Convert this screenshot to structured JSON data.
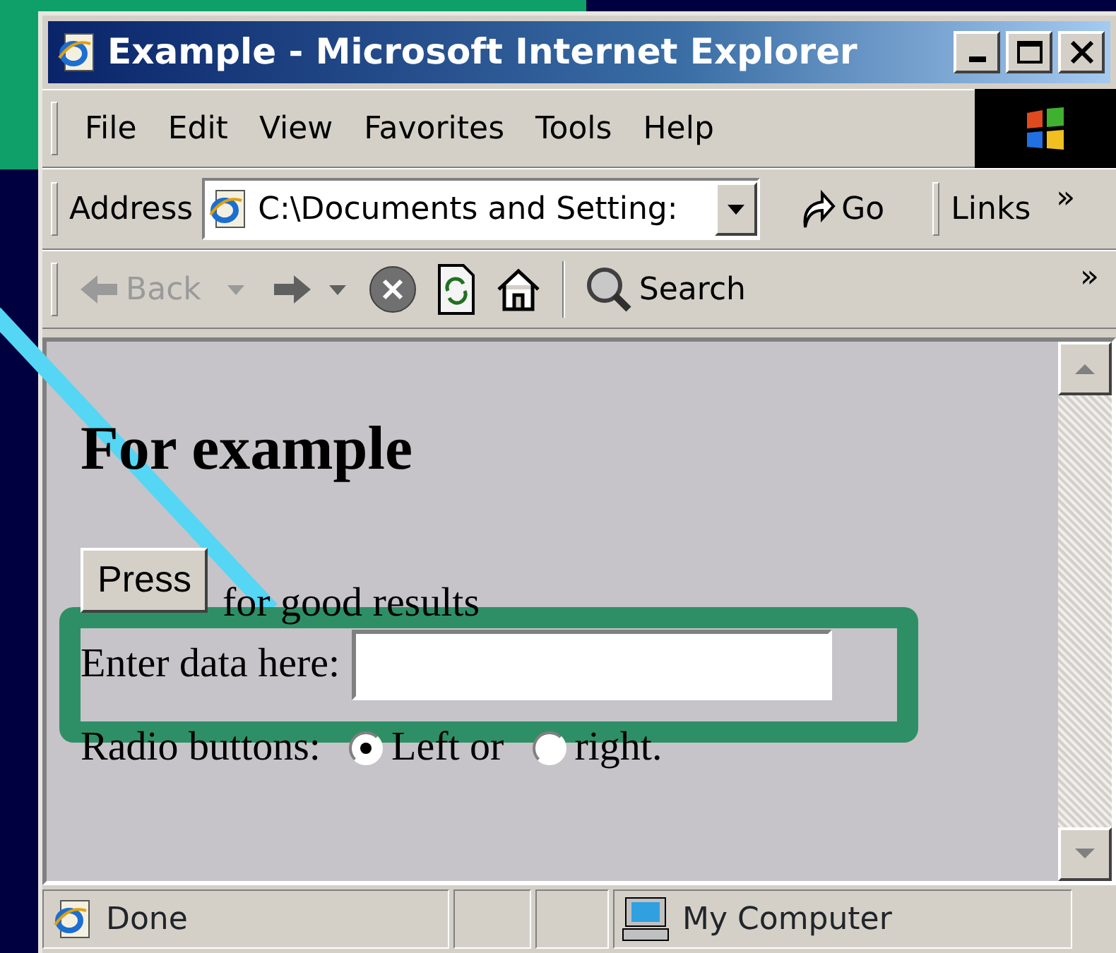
{
  "window": {
    "title": "Example - Microsoft Internet Explorer"
  },
  "menu": [
    "File",
    "Edit",
    "View",
    "Favorites",
    "Tools",
    "Help"
  ],
  "address_bar": {
    "label": "Address",
    "value": "C:\\Documents and Setting:",
    "go": "Go",
    "links": "Links",
    "more": "»"
  },
  "toolbar": {
    "items": [
      {
        "kind": "back",
        "label": "Back",
        "disabled": true
      },
      {
        "kind": "forward",
        "disabled": false
      },
      {
        "kind": "stop"
      },
      {
        "kind": "refresh"
      },
      {
        "kind": "home"
      },
      {
        "kind": "search",
        "label": "Search"
      }
    ],
    "more": "»"
  },
  "content": {
    "heading": "For example",
    "button": "Press",
    "button_text": "for good results",
    "field_label": "Enter data here:",
    "radio_label": "Radio buttons:",
    "radios": [
      {
        "label": "Left or",
        "selected": true
      },
      {
        "label": "right.",
        "selected": false
      }
    ]
  },
  "status_bar": {
    "text": "Done",
    "zone": "My Computer"
  }
}
